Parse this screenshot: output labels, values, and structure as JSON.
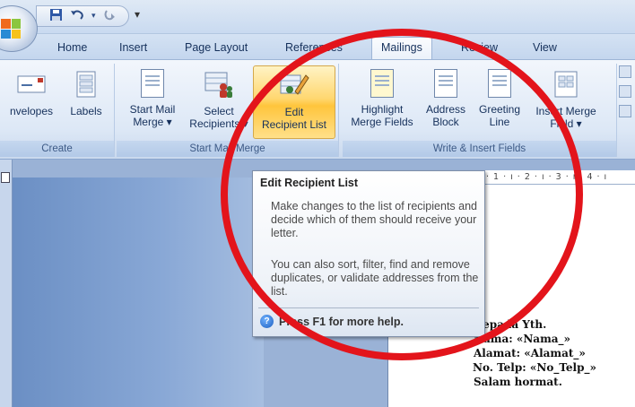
{
  "qat": {
    "save_icon": "save-icon",
    "undo_icon": "undo-icon",
    "redo_icon": "redo-icon",
    "customize_label": "▾"
  },
  "tabs": [
    "Home",
    "Insert",
    "Page Layout",
    "References",
    "Mailings",
    "Review",
    "View"
  ],
  "active_tab": "Mailings",
  "ribbon": {
    "create": {
      "label": "Create",
      "envelopes": "nvelopes",
      "labels": "Labels"
    },
    "start_mail_merge": {
      "label": "Start Mail Merge",
      "start_line1": "Start Mail",
      "start_line2": "Merge ▾",
      "select_line1": "Select",
      "select_line2": "Recipients ▾",
      "edit_line1": "Edit",
      "edit_line2": "Recipient List"
    },
    "write_insert": {
      "label": "Write & Insert Fields",
      "highlight_line1": "Highlight",
      "highlight_line2": "Merge Fields",
      "address_line1": "Address",
      "address_line2": "Block",
      "greeting_line1": "Greeting",
      "greeting_line2": "Line",
      "insert_line1": "Insert Merge",
      "insert_line2": "Field ▾"
    }
  },
  "ruler_text": "· 1 · ı · 2 · ı · 3 · ı · 4 · ı",
  "tooltip": {
    "title": "Edit Recipient List",
    "p1": "Make changes to the list of recipients and decide which of them should receive your letter.",
    "p2": "You can also sort, filter, find and remove duplicates, or validate addresses from the list.",
    "help": "Press F1 for more help."
  },
  "letter": {
    "line1": "Kepada Yth.",
    "line2": "Nama: «Nama_»",
    "line3": "Alamat: «Alamat_»",
    "line4": "No. Telp: «No_Telp_»",
    "line5": "Salam hormat."
  },
  "colors": {
    "annotation": "#e3141b",
    "highlight": "#ffc53c"
  }
}
